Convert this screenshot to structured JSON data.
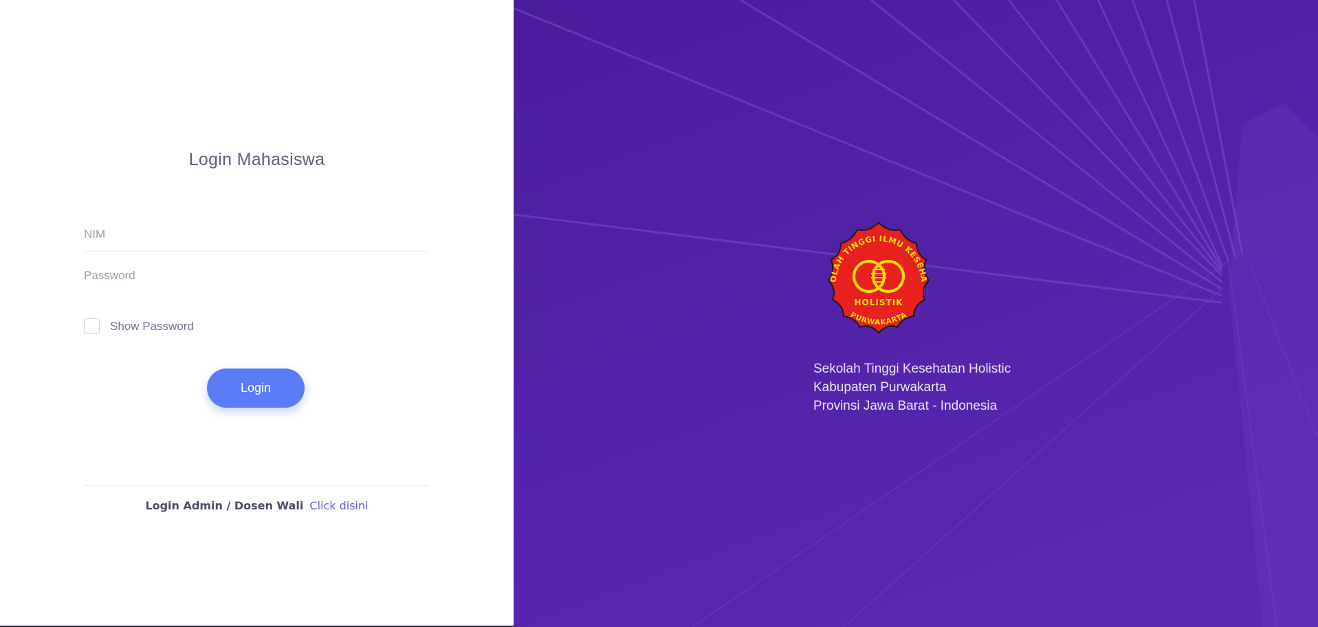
{
  "login": {
    "title": "Login Mahasiswa",
    "nim_placeholder": "NIM",
    "nim_value": "",
    "password_placeholder": "Password",
    "password_value": "",
    "show_password_label": "Show Password",
    "show_password_checked": false,
    "submit_label": "Login"
  },
  "footer": {
    "text": "Login Admin / Dosen Wali",
    "link_text": "Click disini"
  },
  "branding": {
    "logo": {
      "icon": "school-seal-logo",
      "top_text": "SEKOLAH TINGGI ILMU KESEHATAN",
      "middle_text": "HOLISTIK",
      "bottom_text": "PURWAKARTA"
    },
    "address_lines": [
      "Sekolah Tinggi Kesehatan Holistic",
      "Kabupaten Purwakarta",
      "Provinsi Jawa Barat - Indonesia"
    ]
  },
  "colors": {
    "accent": "#5b7cf7",
    "panel_purple": "#5223a8",
    "seal_red": "#e8201f",
    "seal_yellow": "#ffe000"
  }
}
